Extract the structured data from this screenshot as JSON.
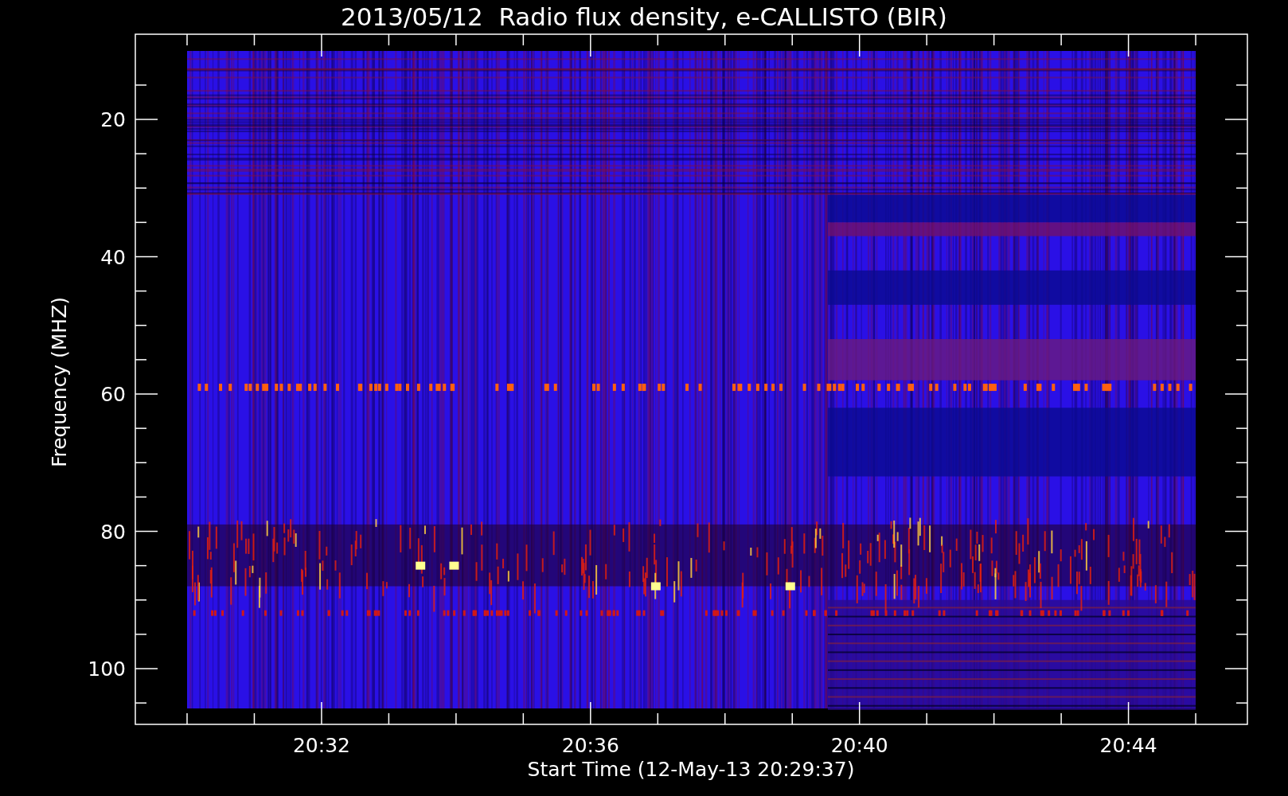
{
  "title": "2013/05/12  Radio flux density, e-CALLISTO (BIR)",
  "y_axis": {
    "label": "Frequency (MHZ)",
    "ticks": [
      "20",
      "40",
      "60",
      "80",
      "100"
    ]
  },
  "x_axis": {
    "label": "Start Time (12-May-13 20:29:37)",
    "ticks": [
      "20:32",
      "20:36",
      "20:40",
      "20:44"
    ]
  }
}
